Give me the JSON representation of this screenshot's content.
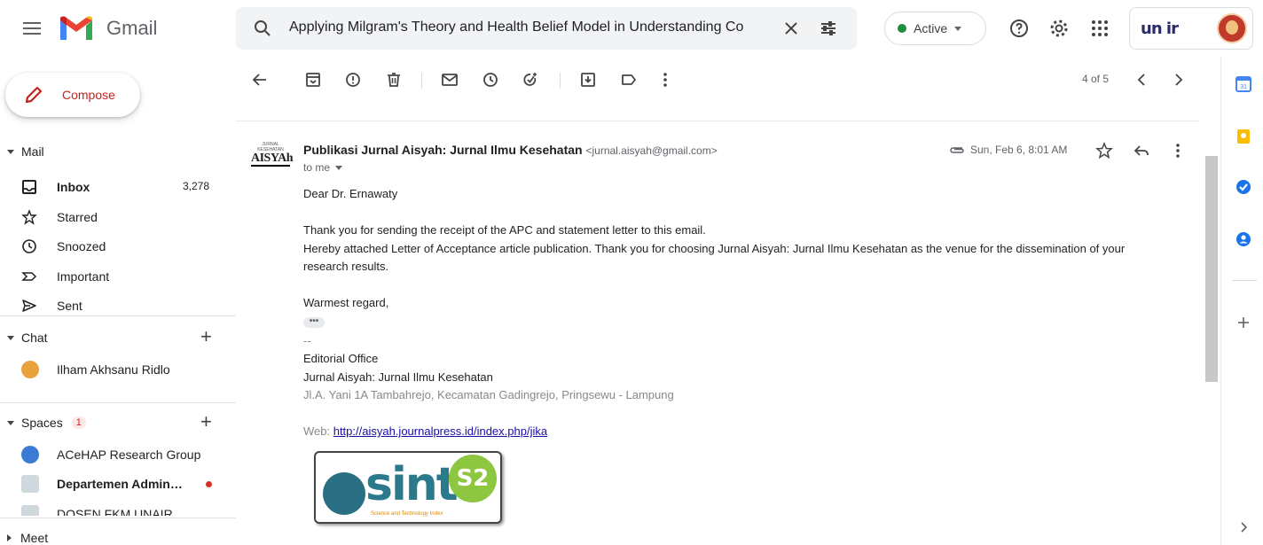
{
  "header": {
    "app_name": "Gmail",
    "search_text": "Applying Milgram's Theory and Health Belief Model in Understanding Co",
    "status_label": "Active",
    "account_logo_text": "un  ir"
  },
  "sidebar": {
    "compose_label": "Compose",
    "mail_section": "Mail",
    "items": [
      {
        "label": "Inbox",
        "count": "3,278",
        "icon": "inbox-icon"
      },
      {
        "label": "Starred",
        "count": "",
        "icon": "star-icon"
      },
      {
        "label": "Snoozed",
        "count": "",
        "icon": "clock-icon"
      },
      {
        "label": "Important",
        "count": "",
        "icon": "important-icon"
      },
      {
        "label": "Sent",
        "count": "",
        "icon": "send-icon"
      }
    ],
    "chat_section": "Chat",
    "chat_contacts": [
      {
        "name": "Ilham Akhsanu Ridlo"
      }
    ],
    "spaces_section": "Spaces",
    "spaces_badge": "1",
    "spaces": [
      {
        "name": "ACeHAP Research Group"
      },
      {
        "name": "Departemen Admin…"
      },
      {
        "name": "DOSEN FKM UNAIR"
      }
    ],
    "meet_section": "Meet"
  },
  "toolbar": {
    "pager_text": "4 of 5"
  },
  "message": {
    "sender_logo_text": "AISYAh",
    "sender_logo_small": "JURNAL KESEHATAN",
    "from_name": "Publikasi Jurnal Aisyah: Jurnal Ilmu Kesehatan",
    "from_email": "<jurnal.aisyah@gmail.com>",
    "to_label": "to me",
    "date": "Sun, Feb 6, 8:01 AM",
    "greeting": "Dear Dr. Ernawaty",
    "line1": "Thank you for sending the receipt of the APC and statement letter to this email.",
    "line2": "Hereby attached Letter of Acceptance article publication. Thank you for choosing Jurnal Aisyah: Jurnal Ilmu Kesehatan as the venue for the dissemination of your",
    "line3": "research results.",
    "closing": "Warmest regard,",
    "ellipsis": "•••",
    "dashes": "--",
    "sig_office": "Editorial Office",
    "sig_journal": "Jurnal Aisyah: Jurnal Ilmu Kesehatan",
    "sig_address": "Jl.A. Yani 1A Tambahrejo, Kecamatan Gadingrejo, Pringsewu - Lampung",
    "web_label": "Web: ",
    "web_link": "http://aisyah.journalpress.id/index.php/jika",
    "sinta_text": "sinta",
    "sinta_badge": "S2",
    "sinta_sub": "Science and Technology Index"
  },
  "colors": {
    "compose_accent": "#c5221f",
    "active_dot": "#1e8e3e",
    "link": "#1a0dab"
  }
}
